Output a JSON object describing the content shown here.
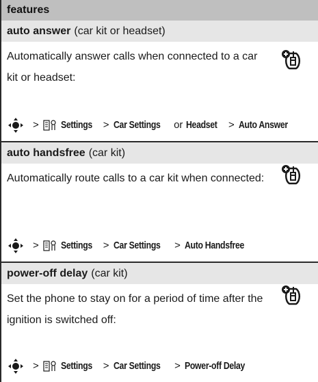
{
  "header": {
    "title": "features"
  },
  "features": [
    {
      "name": "auto answer",
      "qualifier": "(car kit or headset)",
      "description": "Automatically answer calls when connected to a car kit or headset:",
      "path": {
        "settings": "Settings",
        "step1": "Car Settings",
        "or": "or",
        "step1_alt": "Headset",
        "step2": "Auto Answer"
      }
    },
    {
      "name": "auto handsfree",
      "qualifier": "(car kit)",
      "description": "Automatically route calls to a car kit when connected:",
      "path": {
        "settings": "Settings",
        "step1": "Car Settings",
        "step2": "Auto Handsfree"
      }
    },
    {
      "name": "power-off delay",
      "qualifier": "(car kit)",
      "description": "Set the phone to stay on for a period of time after the ignition is switched off:",
      "path": {
        "settings": "Settings",
        "step1": "Car Settings",
        "step2": "Power-off Delay"
      }
    }
  ],
  "separator": ">",
  "icons": {
    "nav": "navigation-key-icon",
    "settings": "settings-icon",
    "feature": "network-feature-icon"
  }
}
